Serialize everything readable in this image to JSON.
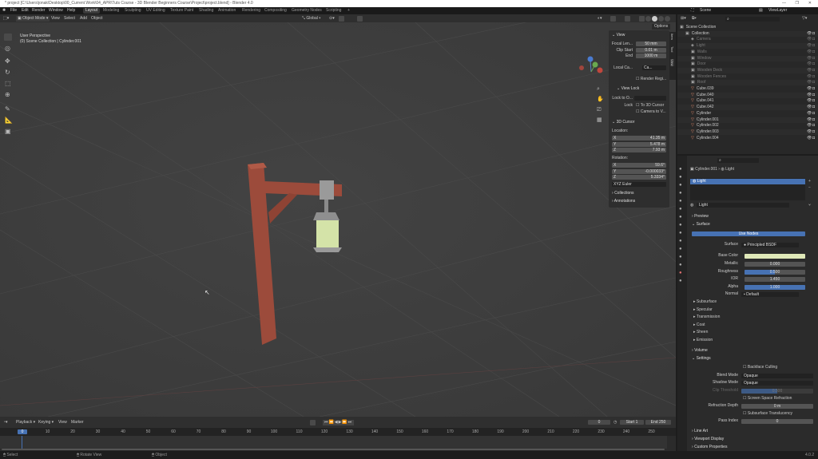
{
  "window": {
    "title": "* project [C:\\Users\\jonak\\Desktop\\00_Current Work\\04_APR\\Tuts Course - 3D Blender Beginners Course\\Project\\project.blend] - Blender 4.0"
  },
  "menus": [
    "File",
    "Edit",
    "Render",
    "Window",
    "Help"
  ],
  "workspaces": [
    "Layout",
    "Modeling",
    "Sculpting",
    "UV Editing",
    "Texture Paint",
    "Shading",
    "Animation",
    "Rendering",
    "Compositing",
    "Geometry Nodes",
    "Scripting",
    "+"
  ],
  "scene": {
    "scene_name": "Scene",
    "view_layer": "ViewLayer"
  },
  "viewport": {
    "mode": "Object Mode",
    "menus": [
      "View",
      "Select",
      "Add",
      "Object"
    ],
    "transform": "Global",
    "options": "Options",
    "perspective": "User Perspective",
    "collection_info": "(0) Scene Collection | Cylinder.001"
  },
  "npanel": {
    "view_title": "View",
    "focal_label": "Focal Len...",
    "focal": "50 mm",
    "clip_start_label": "Clip Start",
    "clip_start": "0.01 m",
    "end_label": "End",
    "end": "1000 m",
    "local_camera_label": "Local Ca...",
    "local_camera": "Ca...",
    "render_region": "Render Regi...",
    "view_lock_title": "View Lock",
    "lock_to_label": "Lock to O...",
    "lock_label": "Lock",
    "to_3d_cursor": "To 3D Cursor",
    "camera_to_view": "Camera to V...",
    "cursor_title": "3D Cursor",
    "location_label": "Location:",
    "loc": [
      {
        "axis": "X",
        "value": "41.35 m"
      },
      {
        "axis": "Y",
        "value": "5.478 m"
      },
      {
        "axis": "Z",
        "value": "7.93 m"
      }
    ],
    "rotation_label": "Rotation:",
    "rot": [
      {
        "axis": "X",
        "value": "59.6°"
      },
      {
        "axis": "Y",
        "value": "-0.000033°"
      },
      {
        "axis": "Z",
        "value": "5.3334°"
      }
    ],
    "rotation_mode": "XYZ Euler",
    "collections": "Collections",
    "annotations": "Annotations",
    "tabs": [
      "Item",
      "Tool",
      "View"
    ]
  },
  "outliner": {
    "items": [
      {
        "name": "Scene Collection",
        "indent": 0,
        "kind": "scene"
      },
      {
        "name": "Collection",
        "indent": 1,
        "kind": "coll"
      },
      {
        "name": "Camera",
        "indent": 2,
        "kind": "hidden"
      },
      {
        "name": "Light",
        "indent": 2,
        "kind": "hidden"
      },
      {
        "name": "Walls",
        "indent": 2,
        "kind": "collx"
      },
      {
        "name": "Window",
        "indent": 2,
        "kind": "collx"
      },
      {
        "name": "Door",
        "indent": 2,
        "kind": "collx"
      },
      {
        "name": "Wooden Deck",
        "indent": 2,
        "kind": "collx"
      },
      {
        "name": "Wooden Fences",
        "indent": 2,
        "kind": "collx"
      },
      {
        "name": "Roof",
        "indent": 2,
        "kind": "collx"
      },
      {
        "name": "Cube.039",
        "indent": 2,
        "kind": "mesh"
      },
      {
        "name": "Cube.040",
        "indent": 2,
        "kind": "mesh"
      },
      {
        "name": "Cube.041",
        "indent": 2,
        "kind": "mesh"
      },
      {
        "name": "Cube.042",
        "indent": 2,
        "kind": "mesh"
      },
      {
        "name": "Cylinder",
        "indent": 2,
        "kind": "mesh"
      },
      {
        "name": "Cylinder.001",
        "indent": 2,
        "kind": "mesh"
      },
      {
        "name": "Cylinder.002",
        "indent": 2,
        "kind": "mesh"
      },
      {
        "name": "Cylinder.003",
        "indent": 2,
        "kind": "mesh"
      },
      {
        "name": "Cylinder.004",
        "indent": 2,
        "kind": "mesh"
      }
    ]
  },
  "properties": {
    "object": "Cylinder.001",
    "material": "Light",
    "slot": "Light",
    "material_name": "Light",
    "preview": "Preview",
    "surface_section": "Surface",
    "use_nodes": "Use Nodes",
    "surface_label": "Surface",
    "surface_value": "Principled BSDF",
    "base_color_label": "Base Color",
    "base_color": "#dfe8b8",
    "inputs": [
      {
        "label": "Metallic",
        "value": "0.000",
        "fill": 0
      },
      {
        "label": "Roughness",
        "value": "0.500",
        "fill": 0.5
      },
      {
        "label": "IOR",
        "value": "1.450",
        "fill": 0
      },
      {
        "label": "Alpha",
        "value": "1.000",
        "fill": 1
      }
    ],
    "normal_label": "Normal",
    "normal_value": "Default",
    "subpanels": [
      "Subsurface",
      "Specular",
      "Transmission",
      "Coat",
      "Sheen",
      "Emission"
    ],
    "volume": "Volume",
    "settings": "Settings",
    "backface": "Backface Culling",
    "blend_label": "Blend Mode",
    "blend": "Opaque",
    "shadow_label": "Shadow Mode",
    "shadow": "Opaque",
    "clip_label": "Clip Threshold",
    "clip": "0.500",
    "clip_fill": 0.5,
    "ssr": "Screen Space Refraction",
    "refr_label": "Refraction Depth",
    "refr": "0 m",
    "sss": "Subsurface Translucency",
    "pass_label": "Pass Index",
    "pass": "0",
    "line_art": "Line Art",
    "viewport_display": "Viewport Display",
    "custom_props": "Custom Properties"
  },
  "timeline": {
    "menus": [
      "Playback",
      "Keying",
      "View",
      "Marker"
    ],
    "current_frame": "0",
    "start_label": "Start",
    "start": "1",
    "end_label": "End",
    "end": "250",
    "ticks": [
      "0",
      "10",
      "20",
      "30",
      "40",
      "50",
      "60",
      "70",
      "80",
      "90",
      "100",
      "110",
      "120",
      "130",
      "140",
      "150",
      "160",
      "170",
      "180",
      "190",
      "200",
      "210",
      "220",
      "230",
      "240",
      "250"
    ]
  },
  "status": {
    "select": "Select",
    "rotate": "Rotate View",
    "object": "Object",
    "version": "4.0.2"
  },
  "colors": {
    "accent": "#4772b3",
    "post": "#9c4b3b",
    "lantern_glass": "#d4e3a8"
  }
}
